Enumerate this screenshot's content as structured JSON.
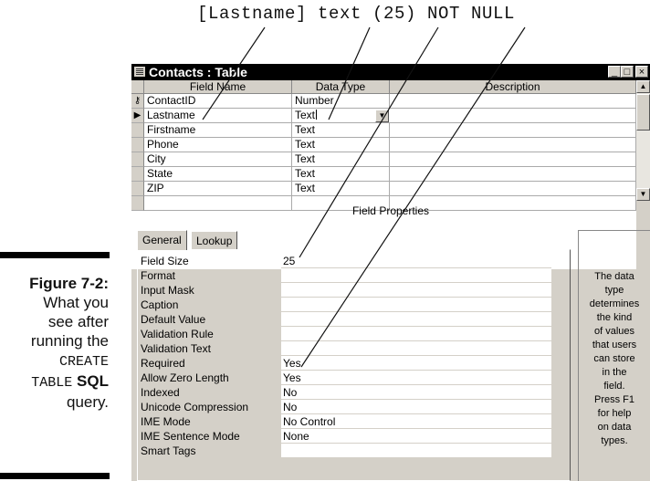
{
  "callout": "[Lastname] text (25) NOT NULL",
  "figure": {
    "label": "Figure 7-2:",
    "line1": "What you",
    "line2": "see after",
    "line3": "running the",
    "kw1": "CREATE",
    "kw2": "TABLE",
    "kw3": "SQL",
    "line5": "query."
  },
  "window": {
    "title": "Contacts : Table",
    "min_label": "_",
    "max_label": "□",
    "close_label": "×"
  },
  "grid": {
    "headers": [
      "Field Name",
      "Data Type",
      "Description"
    ],
    "rows": [
      {
        "name": "ContactID",
        "type": "Number",
        "desc": "",
        "marker": "key-icon"
      },
      {
        "name": "Lastname",
        "type": "Text",
        "desc": "",
        "marker": "current-row-arrow-icon"
      },
      {
        "name": "Firstname",
        "type": "Text",
        "desc": "",
        "marker": ""
      },
      {
        "name": "Phone",
        "type": "Text",
        "desc": "",
        "marker": ""
      },
      {
        "name": "City",
        "type": "Text",
        "desc": "",
        "marker": ""
      },
      {
        "name": "State",
        "type": "Text",
        "desc": "",
        "marker": ""
      },
      {
        "name": "ZIP",
        "type": "Text",
        "desc": "",
        "marker": ""
      },
      {
        "name": "",
        "type": "",
        "desc": "",
        "marker": ""
      }
    ]
  },
  "field_properties": {
    "label": "Field Properties",
    "tabs": [
      "General",
      "Lookup"
    ],
    "active_tab": "General",
    "props": [
      {
        "label": "Field Size",
        "value": "25"
      },
      {
        "label": "Format",
        "value": ""
      },
      {
        "label": "Input Mask",
        "value": ""
      },
      {
        "label": "Caption",
        "value": ""
      },
      {
        "label": "Default Value",
        "value": ""
      },
      {
        "label": "Validation Rule",
        "value": ""
      },
      {
        "label": "Validation Text",
        "value": ""
      },
      {
        "label": "Required",
        "value": "Yes"
      },
      {
        "label": "Allow Zero Length",
        "value": "Yes"
      },
      {
        "label": "Indexed",
        "value": "No"
      },
      {
        "label": "Unicode Compression",
        "value": "No"
      },
      {
        "label": "IME Mode",
        "value": "No Control"
      },
      {
        "label": "IME Sentence Mode",
        "value": "None"
      },
      {
        "label": "Smart Tags",
        "value": ""
      }
    ],
    "help": [
      "The data",
      "type",
      "determines",
      "the kind",
      "of values",
      "that users",
      "can store",
      "in the",
      "field.",
      "Press F1",
      "for help",
      "on data",
      "types."
    ]
  }
}
